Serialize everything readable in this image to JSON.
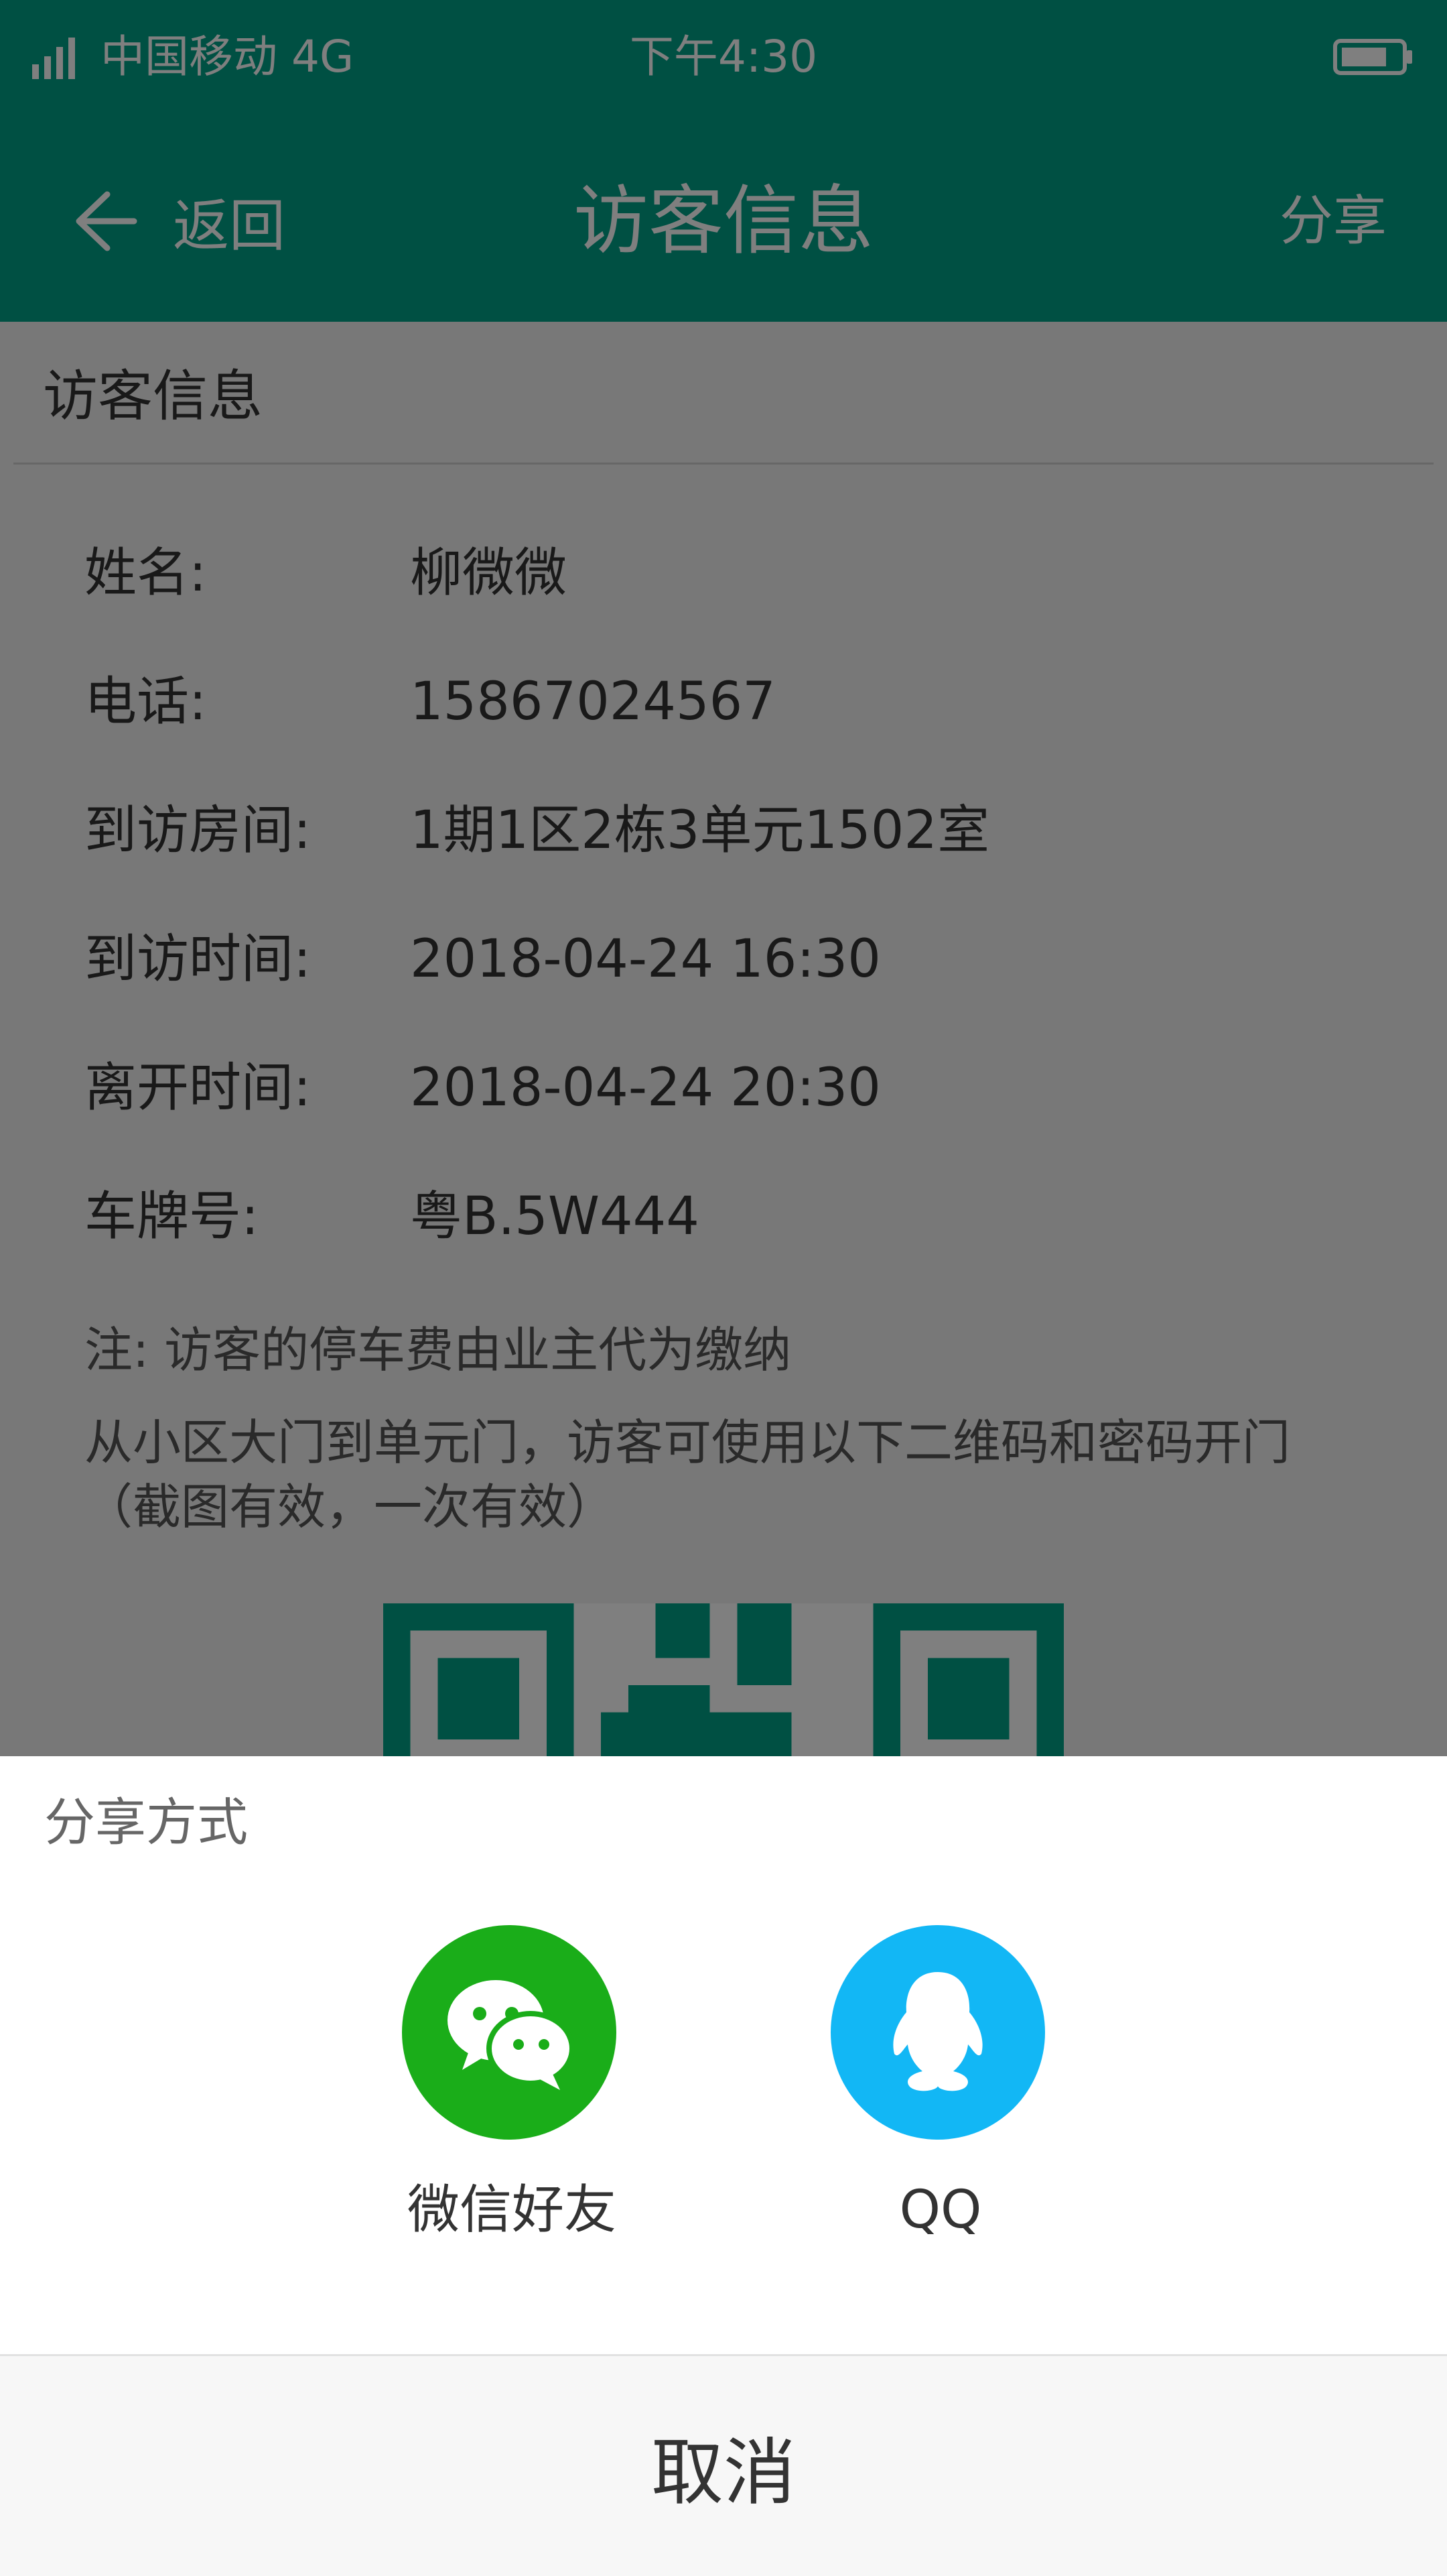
{
  "status_bar": {
    "carrier": "中国移动  4G",
    "time": "下午4:30"
  },
  "nav": {
    "back_label": "返回",
    "title": "访客信息",
    "share_label": "分享"
  },
  "section": {
    "title": "访客信息"
  },
  "visitor": {
    "name_label": "姓名:",
    "name": "柳微微",
    "phone_label": "电话:",
    "phone": "15867024567",
    "room_label": "到访房间:",
    "room": "1期1区2栋3单元1502室",
    "visit_time_label": "到访时间:",
    "visit_time": "2018-04-24    16:30",
    "leave_time_label": "离开时间:",
    "leave_time": "2018-04-24    20:30",
    "plate_label": "车牌号:",
    "plate": "粤B.5W444"
  },
  "notes": {
    "parking": "注:  访客的停车费由业主代为缴纳",
    "access_line1": "从小区大门到单元门，访客可使用以下二维码和密码开门",
    "access_line2": "（截图有效，一次有效）"
  },
  "colors": {
    "brand": "#00a086",
    "wechat": "#1aad19",
    "qq": "#12b7f5"
  },
  "share_sheet": {
    "title": "分享方式",
    "options": [
      {
        "label": "微信好友",
        "icon": "wechat-icon"
      },
      {
        "label": "QQ",
        "icon": "qq-icon"
      }
    ],
    "cancel_label": "取消"
  }
}
